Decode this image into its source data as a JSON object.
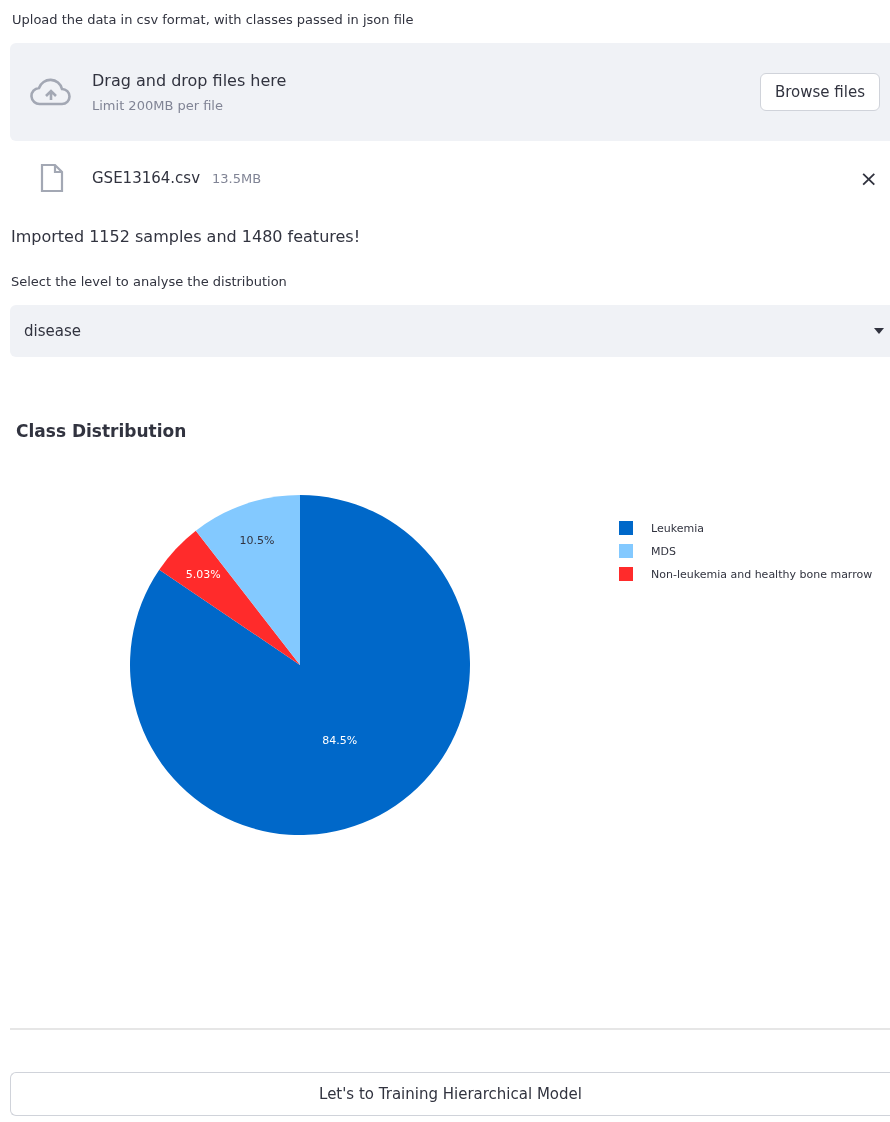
{
  "upload_label": "Upload the data in csv format, with classes passed in json file",
  "dropzone": {
    "title": "Drag and drop files here",
    "hint": "Limit 200MB per file",
    "button": "Browse files"
  },
  "file": {
    "name": "GSE13164.csv",
    "size": "13.5MB",
    "remove": "×"
  },
  "message": "Imported 1152 samples and 1480 features!",
  "select": {
    "label": "Select the level to analyse the distribution",
    "value": "disease"
  },
  "chart_title": "Class Distribution",
  "chart_data": {
    "type": "pie",
    "categories": [
      "Leukemia",
      "Non-leukemia and healthy bone marrow",
      "MDS"
    ],
    "values": [
      84.5,
      5.03,
      10.5
    ],
    "colors": [
      "#0068c9",
      "#ff2b2b",
      "#83c9ff"
    ],
    "value_labels": [
      "84.5%",
      "5.03%",
      "10.5%"
    ]
  },
  "train_button": "Let's to Training Hierarchical Model"
}
